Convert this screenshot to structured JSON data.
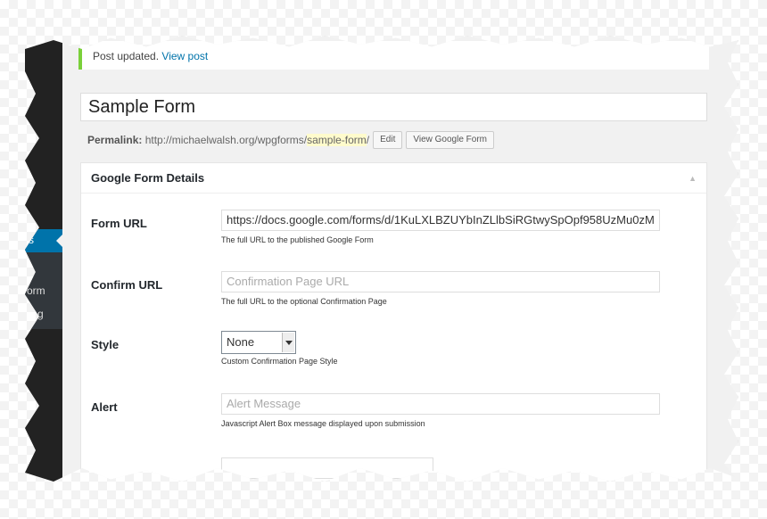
{
  "notice": {
    "text": "Post updated.",
    "link": "View post"
  },
  "post": {
    "title": "Sample Form"
  },
  "permalink": {
    "label": "Permalink:",
    "base": "http://michaelwalsh.org/wpgforms/",
    "slug": "sample-form",
    "suffix": "/",
    "edit_button": "Edit",
    "view_button": "View Google Form"
  },
  "sidebar": {
    "active_label": "s",
    "items": [
      {
        "label": "orm"
      },
      {
        "label": "g"
      }
    ]
  },
  "metabox": {
    "title": "Google Form Details",
    "toggle_icon": "triangle-up-icon",
    "fields": {
      "form_url": {
        "label": "Form URL",
        "value": "https://docs.google.com/forms/d/1KuLXLBZUYbInZLlbSiRGtwySpOpf958UzMu0zM",
        "description": "The full URL to the published Google Form"
      },
      "confirm_url": {
        "label": "Confirm URL",
        "placeholder": "Confirmation Page URL",
        "description": "The full URL to the optional Confirmation Page"
      },
      "style": {
        "label": "Style",
        "selected": "None",
        "description": "Custom Confirmation Page Style"
      },
      "alert": {
        "label": "Alert",
        "placeholder": "Alert Message",
        "description": "Javascript Alert Box message displayed upon submission"
      }
    }
  },
  "colors": {
    "notice_border": "#7ad03a",
    "link": "#0073aa",
    "slug_highlight": "#fffbcc",
    "admin_bar": "#222222",
    "active_menu": "#0073aa"
  }
}
